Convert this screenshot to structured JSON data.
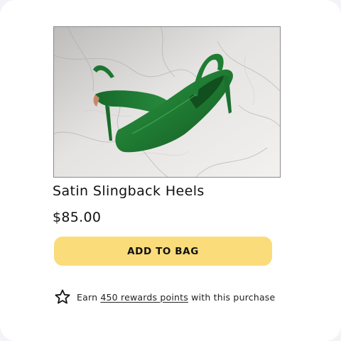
{
  "product": {
    "image_alt": "Green satin slingback heels on marble",
    "name": "Satin Slingback Heels",
    "price": "$85.00"
  },
  "actions": {
    "add_to_bag_label": "ADD TO BAG"
  },
  "rewards": {
    "icon": "star-outline-icon",
    "prefix": "Earn ",
    "link_text": "450 rewards points",
    "suffix": " with this purchase"
  },
  "colors": {
    "button": "#fadc7a",
    "shoe": "#1f7a32",
    "card": "#ffffff",
    "background": "#f4f3f8"
  }
}
